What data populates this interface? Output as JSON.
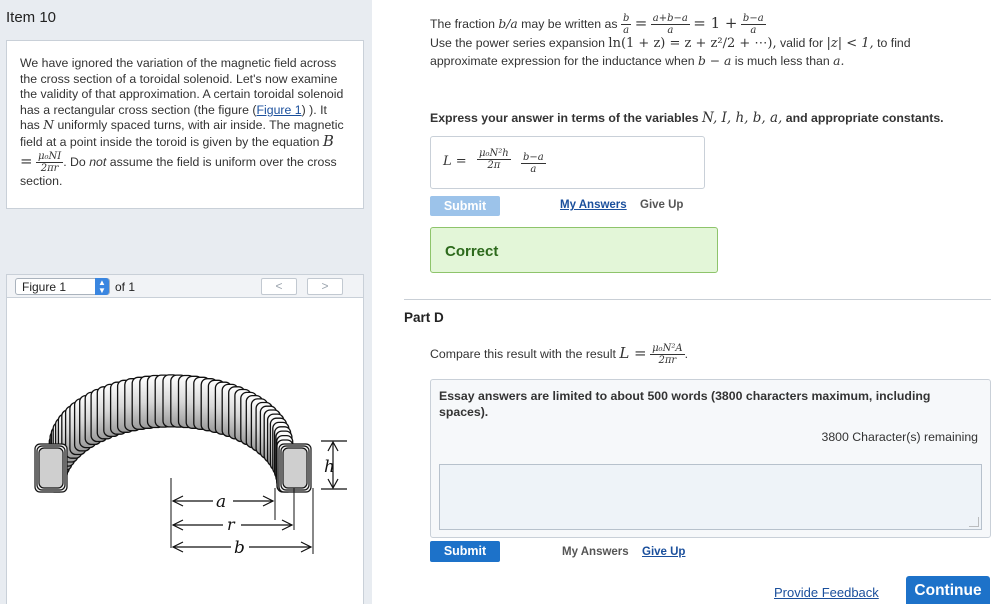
{
  "header": {
    "item_title": "Item 10"
  },
  "intro": {
    "text_1": "We have ignored the variation of the magnetic field across the cross section of a toroidal solenoid. Let's now examine the validity of that approximation. A certain toroidal solenoid has a rectangular cross section (the figure (",
    "figure_link": "Figure 1",
    "text_2": ") ). It has",
    "var_N": "N",
    "text_3": "uniformly spaced turns, with air inside. The magnetic field at a point inside the toroid is given by the equation",
    "eq_B": "B =",
    "eq_num": "μ₀NI",
    "eq_den": "2πr",
    "text_4": ". Do",
    "text_not": "not",
    "text_5": "assume the field is uniform over the cross section."
  },
  "figure_bar": {
    "selected": "Figure 1",
    "of_label": "of 1",
    "prev": "<",
    "next": ">"
  },
  "figure_labels": {
    "h": "h",
    "a": "a",
    "r": "r",
    "b": "b"
  },
  "part_c": {
    "line1_text": "The fraction",
    "line1_var": "b/a",
    "line1_text2": "may be written as",
    "frac1_num": "b",
    "frac1_den": "a",
    "eq1": "=",
    "frac2_num": "a+b−a",
    "frac2_den": "a",
    "eq2": "= 1 +",
    "frac3_num": "b−a",
    "frac3_den": "a",
    "line2_text": "Use the power series expansion",
    "line2_math": "ln(1 + z) = z + z²/2 + ⋯),",
    "line2_text2": "valid for",
    "line2_math2": "|z| < 1,",
    "line2_text3": "to find",
    "line3": "approximate expression for the inductance when",
    "line3_math": "b − a",
    "line3_text2": "is much less than",
    "line3_var": "a.",
    "express_text": "Express your answer in terms of the variables",
    "express_vars": "N, I, h, b, a,",
    "express_text2": "and appropriate constants.",
    "answer_lhs": "L =",
    "answer_num1": "μ₀N²h",
    "answer_den1": "2π",
    "answer_num2": "b−a",
    "answer_den2": "a",
    "submit_label": "Submit",
    "my_answers": "My Answers",
    "give_up": "Give Up",
    "result": "Correct"
  },
  "part_d": {
    "title": "Part D",
    "compare_text": "Compare this result with the result",
    "compare_lhs": "L =",
    "compare_num": "μ₀N²A",
    "compare_den": "2πr",
    "essay_instructions": "Essay answers are limited to about 500 words (3800 characters maximum, including spaces).",
    "remaining": "3800 Character(s) remaining",
    "submit_label": "Submit",
    "my_answers": "My Answers",
    "give_up": "Give Up"
  },
  "footer": {
    "feedback": "Provide Feedback",
    "continue": "Continue"
  }
}
